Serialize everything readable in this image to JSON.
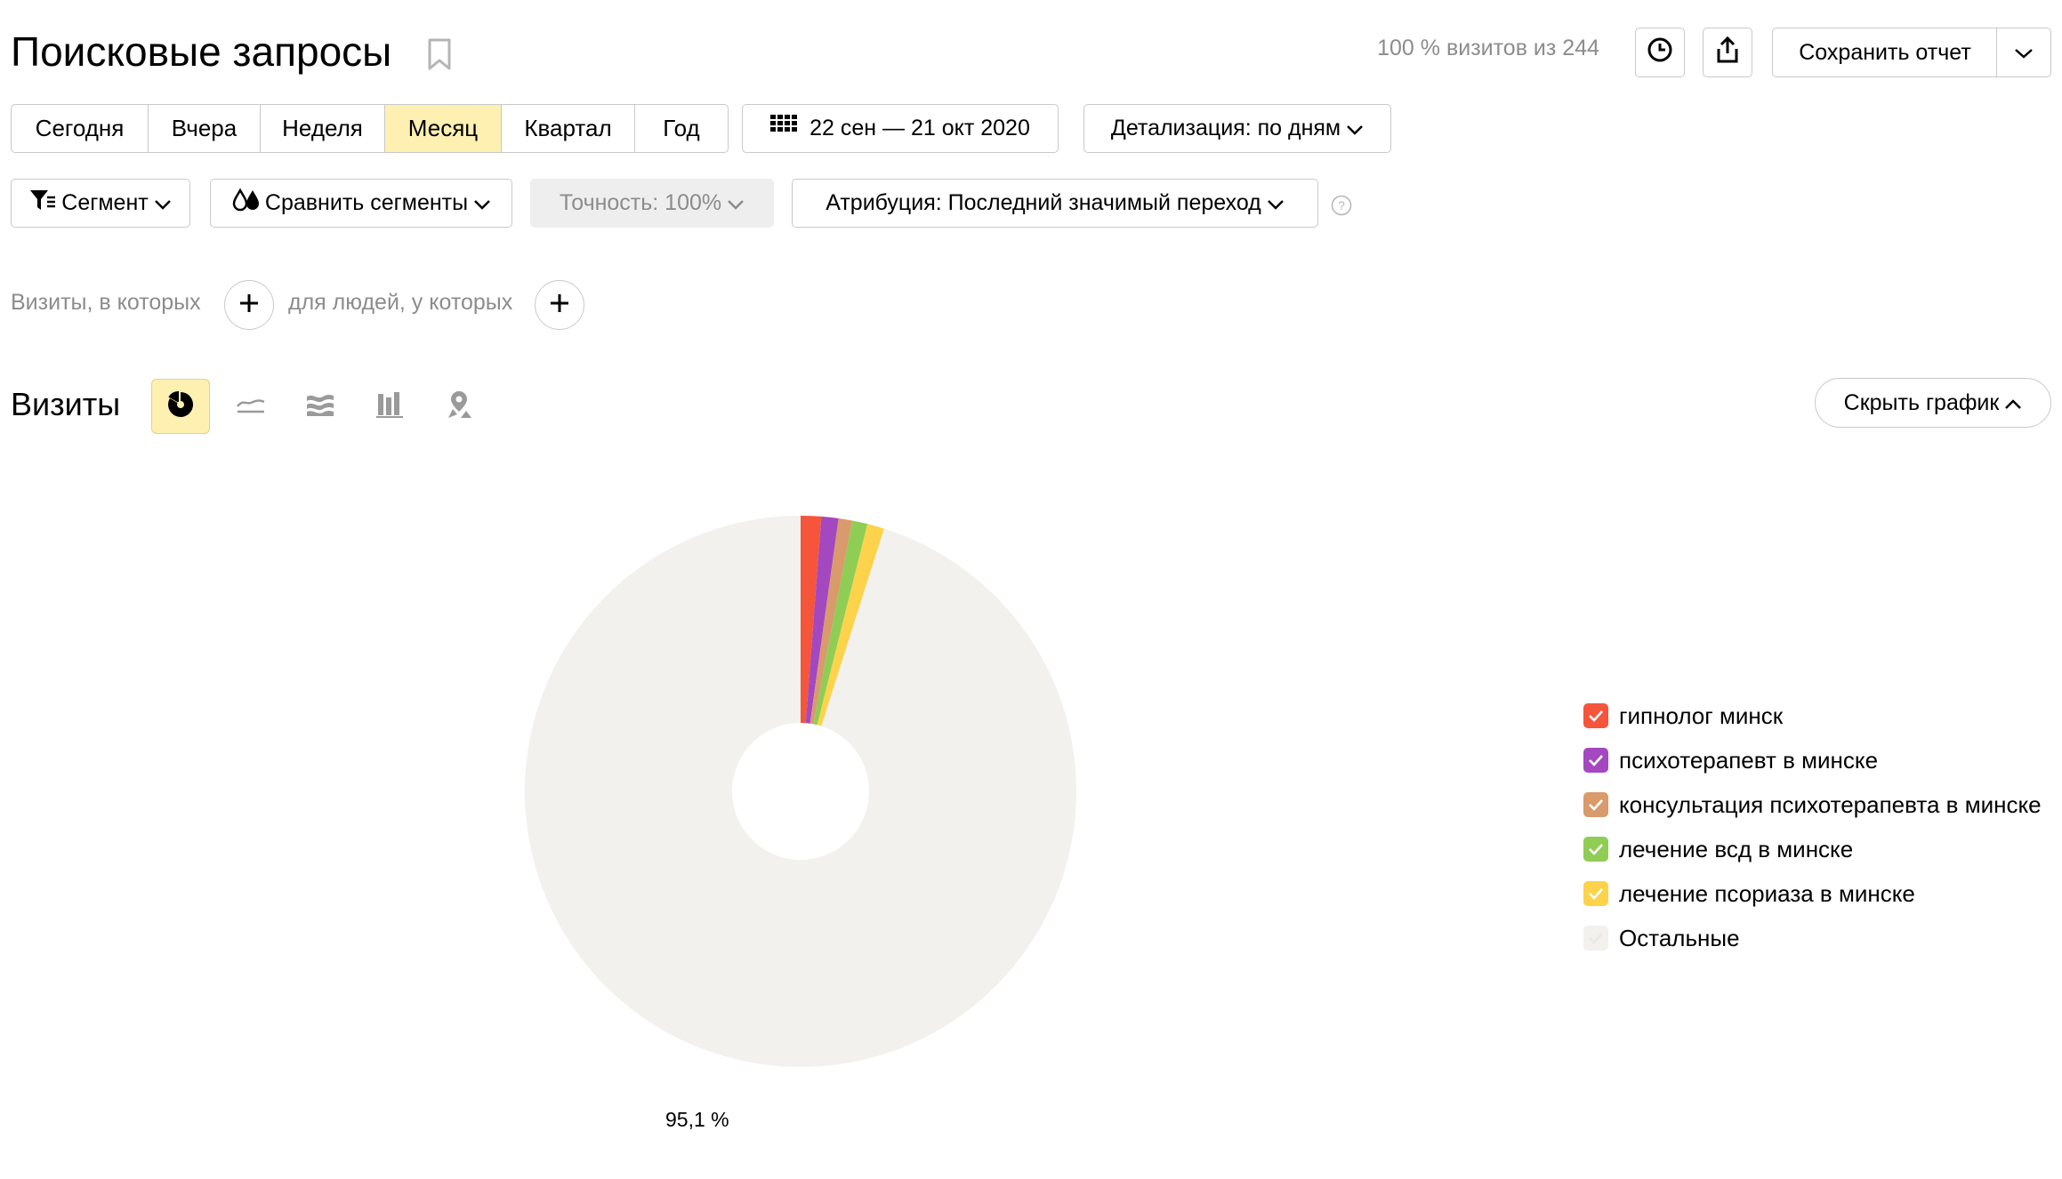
{
  "header": {
    "title": "Поисковые запросы",
    "visits_summary": "100 % визитов из 244",
    "save_label": "Сохранить отчет"
  },
  "period": {
    "options": [
      "Сегодня",
      "Вчера",
      "Неделя",
      "Месяц",
      "Квартал",
      "Год"
    ],
    "active": "Месяц",
    "date_range": "22 сен — 21 окт 2020",
    "detail_label": "Детализация: по дням"
  },
  "filters": {
    "segment_label": "Сегмент",
    "compare_label": "Сравнить сегменты",
    "accuracy_label": "Точность: 100%",
    "attribution_label": "Атрибуция: Последний значимый переход"
  },
  "conditions": {
    "visits_text": "Визиты, в которых",
    "people_text": "для людей, у которых"
  },
  "chart_section": {
    "title": "Визиты",
    "hide_label": "Скрыть график",
    "view_types": [
      "pie-chart",
      "line-chart",
      "area-chart",
      "bar-chart",
      "map"
    ],
    "active_view": "pie-chart"
  },
  "chart_data": {
    "type": "pie",
    "variant": "donut",
    "slices": [
      {
        "label": "гипнолог минск",
        "value": 1.2,
        "color": "#f4553b"
      },
      {
        "label": "психотерапевт в минске",
        "value": 1.0,
        "color": "#a448c0"
      },
      {
        "label": "консультация психотерапевта в минске",
        "value": 0.8,
        "color": "#d99a6c"
      },
      {
        "label": "лечение всд в минске",
        "value": 0.9,
        "color": "#8fcd55"
      },
      {
        "label": "лечение псориаза в минске",
        "value": 1.0,
        "color": "#fcd34a"
      },
      {
        "label": "Остальные",
        "value": 95.1,
        "color": "#f2f1ed"
      }
    ],
    "data_labels": [
      "95,1 %"
    ],
    "legend_position": "right"
  }
}
